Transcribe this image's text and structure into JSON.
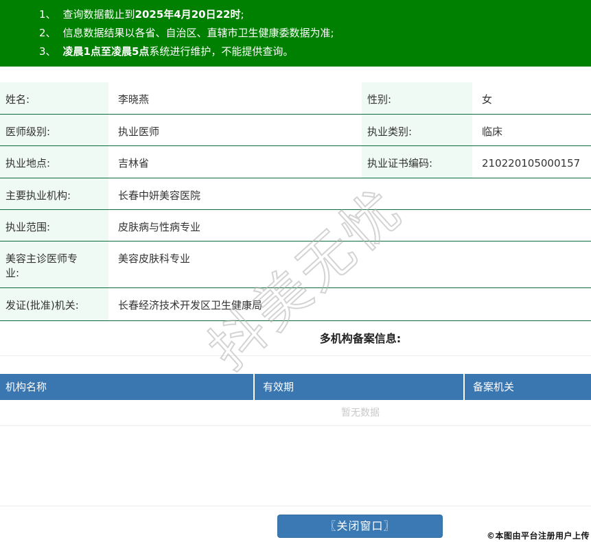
{
  "colors": {
    "banner_green": "#008000",
    "row_border_green": "#0a6b3c",
    "label_bg_mint": "#eefaf3",
    "table_header_blue": "#3a76b0",
    "button_blue": "#3a79b4",
    "empty_text_gray": "#c9c9c9"
  },
  "banner": {
    "notices": [
      {
        "num": "1、",
        "pre": "查询数据截止到",
        "bold": "2025年4月20日22时",
        "post": ";"
      },
      {
        "num": "2、",
        "pre": "信息数据结果以各省、自治区、直辖市卫生健康委数据为准;",
        "bold": "",
        "post": ""
      },
      {
        "num": "3、",
        "pre": "",
        "bold": "凌晨1点至凌晨5点",
        "post": "系统进行维护，不能提供查询。"
      }
    ]
  },
  "info": {
    "rows": [
      {
        "label1": "姓名:",
        "value1": "李晓燕",
        "label2": "性别:",
        "value2": "女"
      },
      {
        "label1": "医师级别:",
        "value1": "执业医师",
        "label2": "执业类别:",
        "value2": "临床"
      },
      {
        "label1": "执业地点:",
        "value1": "吉林省",
        "label2": "执业证书编码:",
        "value2": "210220105000157"
      },
      {
        "label1": "主要执业机构:",
        "value1": "长春中妍美容医院"
      },
      {
        "label1": "执业范围:",
        "value1": "皮肤病与性病专业"
      },
      {
        "label1": "美容主诊医师专业:",
        "value1": "美容皮肤科专业"
      },
      {
        "label1": "发证(批准)机关:",
        "value1": "长春经济技术开发区卫生健康局"
      }
    ]
  },
  "records": {
    "title": "多机构备案信息:",
    "columns": [
      "机构名称",
      "有效期",
      "备案机关"
    ],
    "empty_text": "暂无数据"
  },
  "watermark": {
    "text": "抖美无忧"
  },
  "footer": {
    "close_button": "〖关闭窗口〗",
    "copyright": "©本图由平台注册用户上传"
  }
}
